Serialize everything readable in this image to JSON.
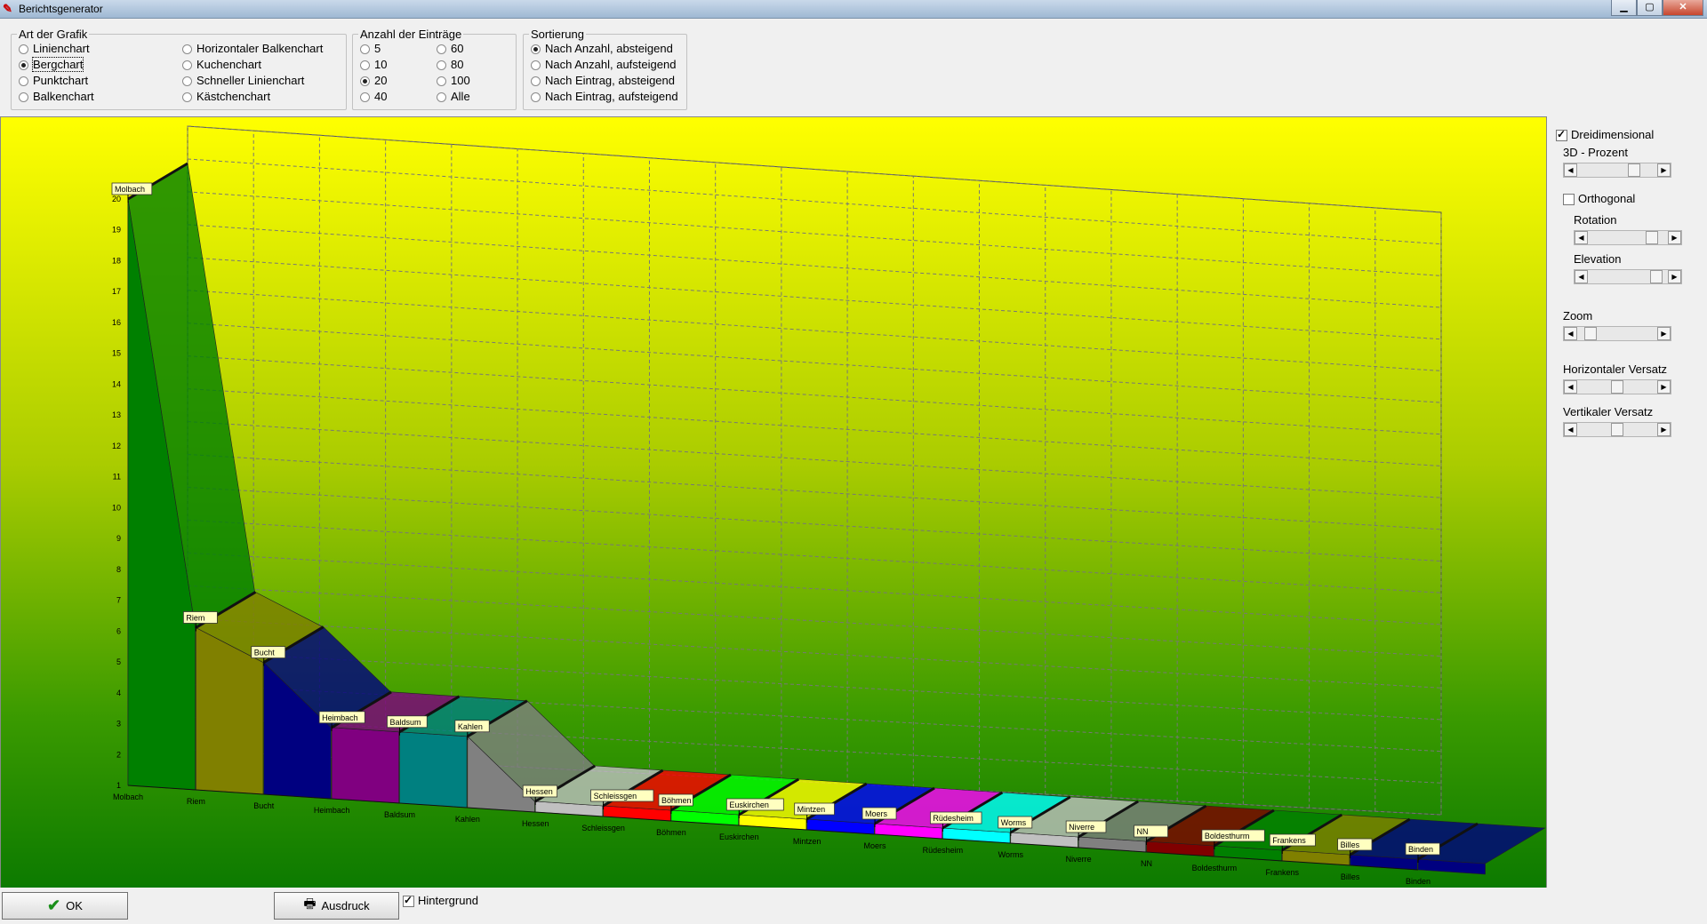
{
  "window": {
    "title": "Berichtsgenerator",
    "icon": "app-red-pencil-icon",
    "minimize": "▁",
    "maximize": "▢",
    "close": "✕"
  },
  "art": {
    "legend": "Art der Grafik",
    "options": [
      "Linienchart",
      "Bergchart",
      "Punktchart",
      "Balkenchart",
      "Horizontaler Balkenchart",
      "Kuchenchart",
      "Schneller Linienchart",
      "Kästchenchart"
    ],
    "selected": "Bergchart"
  },
  "anzahl": {
    "legend": "Anzahl der Einträge",
    "options": [
      "5",
      "10",
      "20",
      "40",
      "60",
      "80",
      "100",
      "Alle"
    ],
    "selected": "20"
  },
  "sortierung": {
    "legend": "Sortierung",
    "options": [
      "Nach Anzahl, absteigend",
      "Nach Anzahl, aufsteigend",
      "Nach Eintrag, absteigend",
      "Nach Eintrag, aufsteigend"
    ],
    "selected": "Nach Anzahl, absteigend"
  },
  "side": {
    "dreidimensional": "Dreidimensional",
    "dreidimensional_checked": true,
    "prozent_label": "3D - Prozent",
    "prozent_value": 0.75,
    "orthogonal": "Orthogonal",
    "orthogonal_checked": false,
    "rotation_label": "Rotation",
    "rotation_value": 0.85,
    "elevation_label": "Elevation",
    "elevation_value": 0.92,
    "zoom_label": "Zoom",
    "zoom_value": 0.1,
    "hversatz_label": "Horizontaler Versatz",
    "hversatz_value": 0.5,
    "vversatz_label": "Vertikaler Versatz",
    "vversatz_value": 0.5
  },
  "bottom": {
    "ok_label": "OK",
    "print_label": "Ausdruck",
    "hintergrund_label": "Hintergrund",
    "hintergrund_checked": true
  },
  "chart_data": {
    "type": "area",
    "style": "3d-mountain",
    "categories": [
      "Molbach",
      "Riem",
      "Bucht",
      "Heimbach",
      "Baldsum",
      "Kahlen",
      "Hessen",
      "Schleissgen",
      "Böhmen",
      "Euskirchen",
      "Mintzen",
      "Moers",
      "Rüdesheim",
      "Worms",
      "Niverre",
      "NN",
      "Boldesthurm",
      "Frankens",
      "Billes",
      "Binden"
    ],
    "values": [
      20,
      6,
      5,
      3,
      3,
      3,
      1,
      1,
      1,
      1,
      1,
      1,
      1,
      1,
      1,
      1,
      1,
      1,
      1,
      1
    ],
    "colors": [
      "#008000",
      "#808000",
      "#000080",
      "#800080",
      "#008080",
      "#808080",
      "#c0c0c0",
      "#ff0000",
      "#00ff00",
      "#ffff00",
      "#0000ff",
      "#ff00ff",
      "#00ffff",
      "#c0c0c0",
      "#808080",
      "#800000",
      "#008000",
      "#808000",
      "#000080",
      "#000080"
    ],
    "yticks": [
      1,
      2,
      3,
      4,
      5,
      6,
      7,
      8,
      9,
      10,
      11,
      12,
      13,
      14,
      15,
      16,
      17,
      18,
      19,
      20
    ],
    "ylim": [
      1,
      20
    ],
    "grid": true,
    "background": "yellow-green-gradient"
  }
}
